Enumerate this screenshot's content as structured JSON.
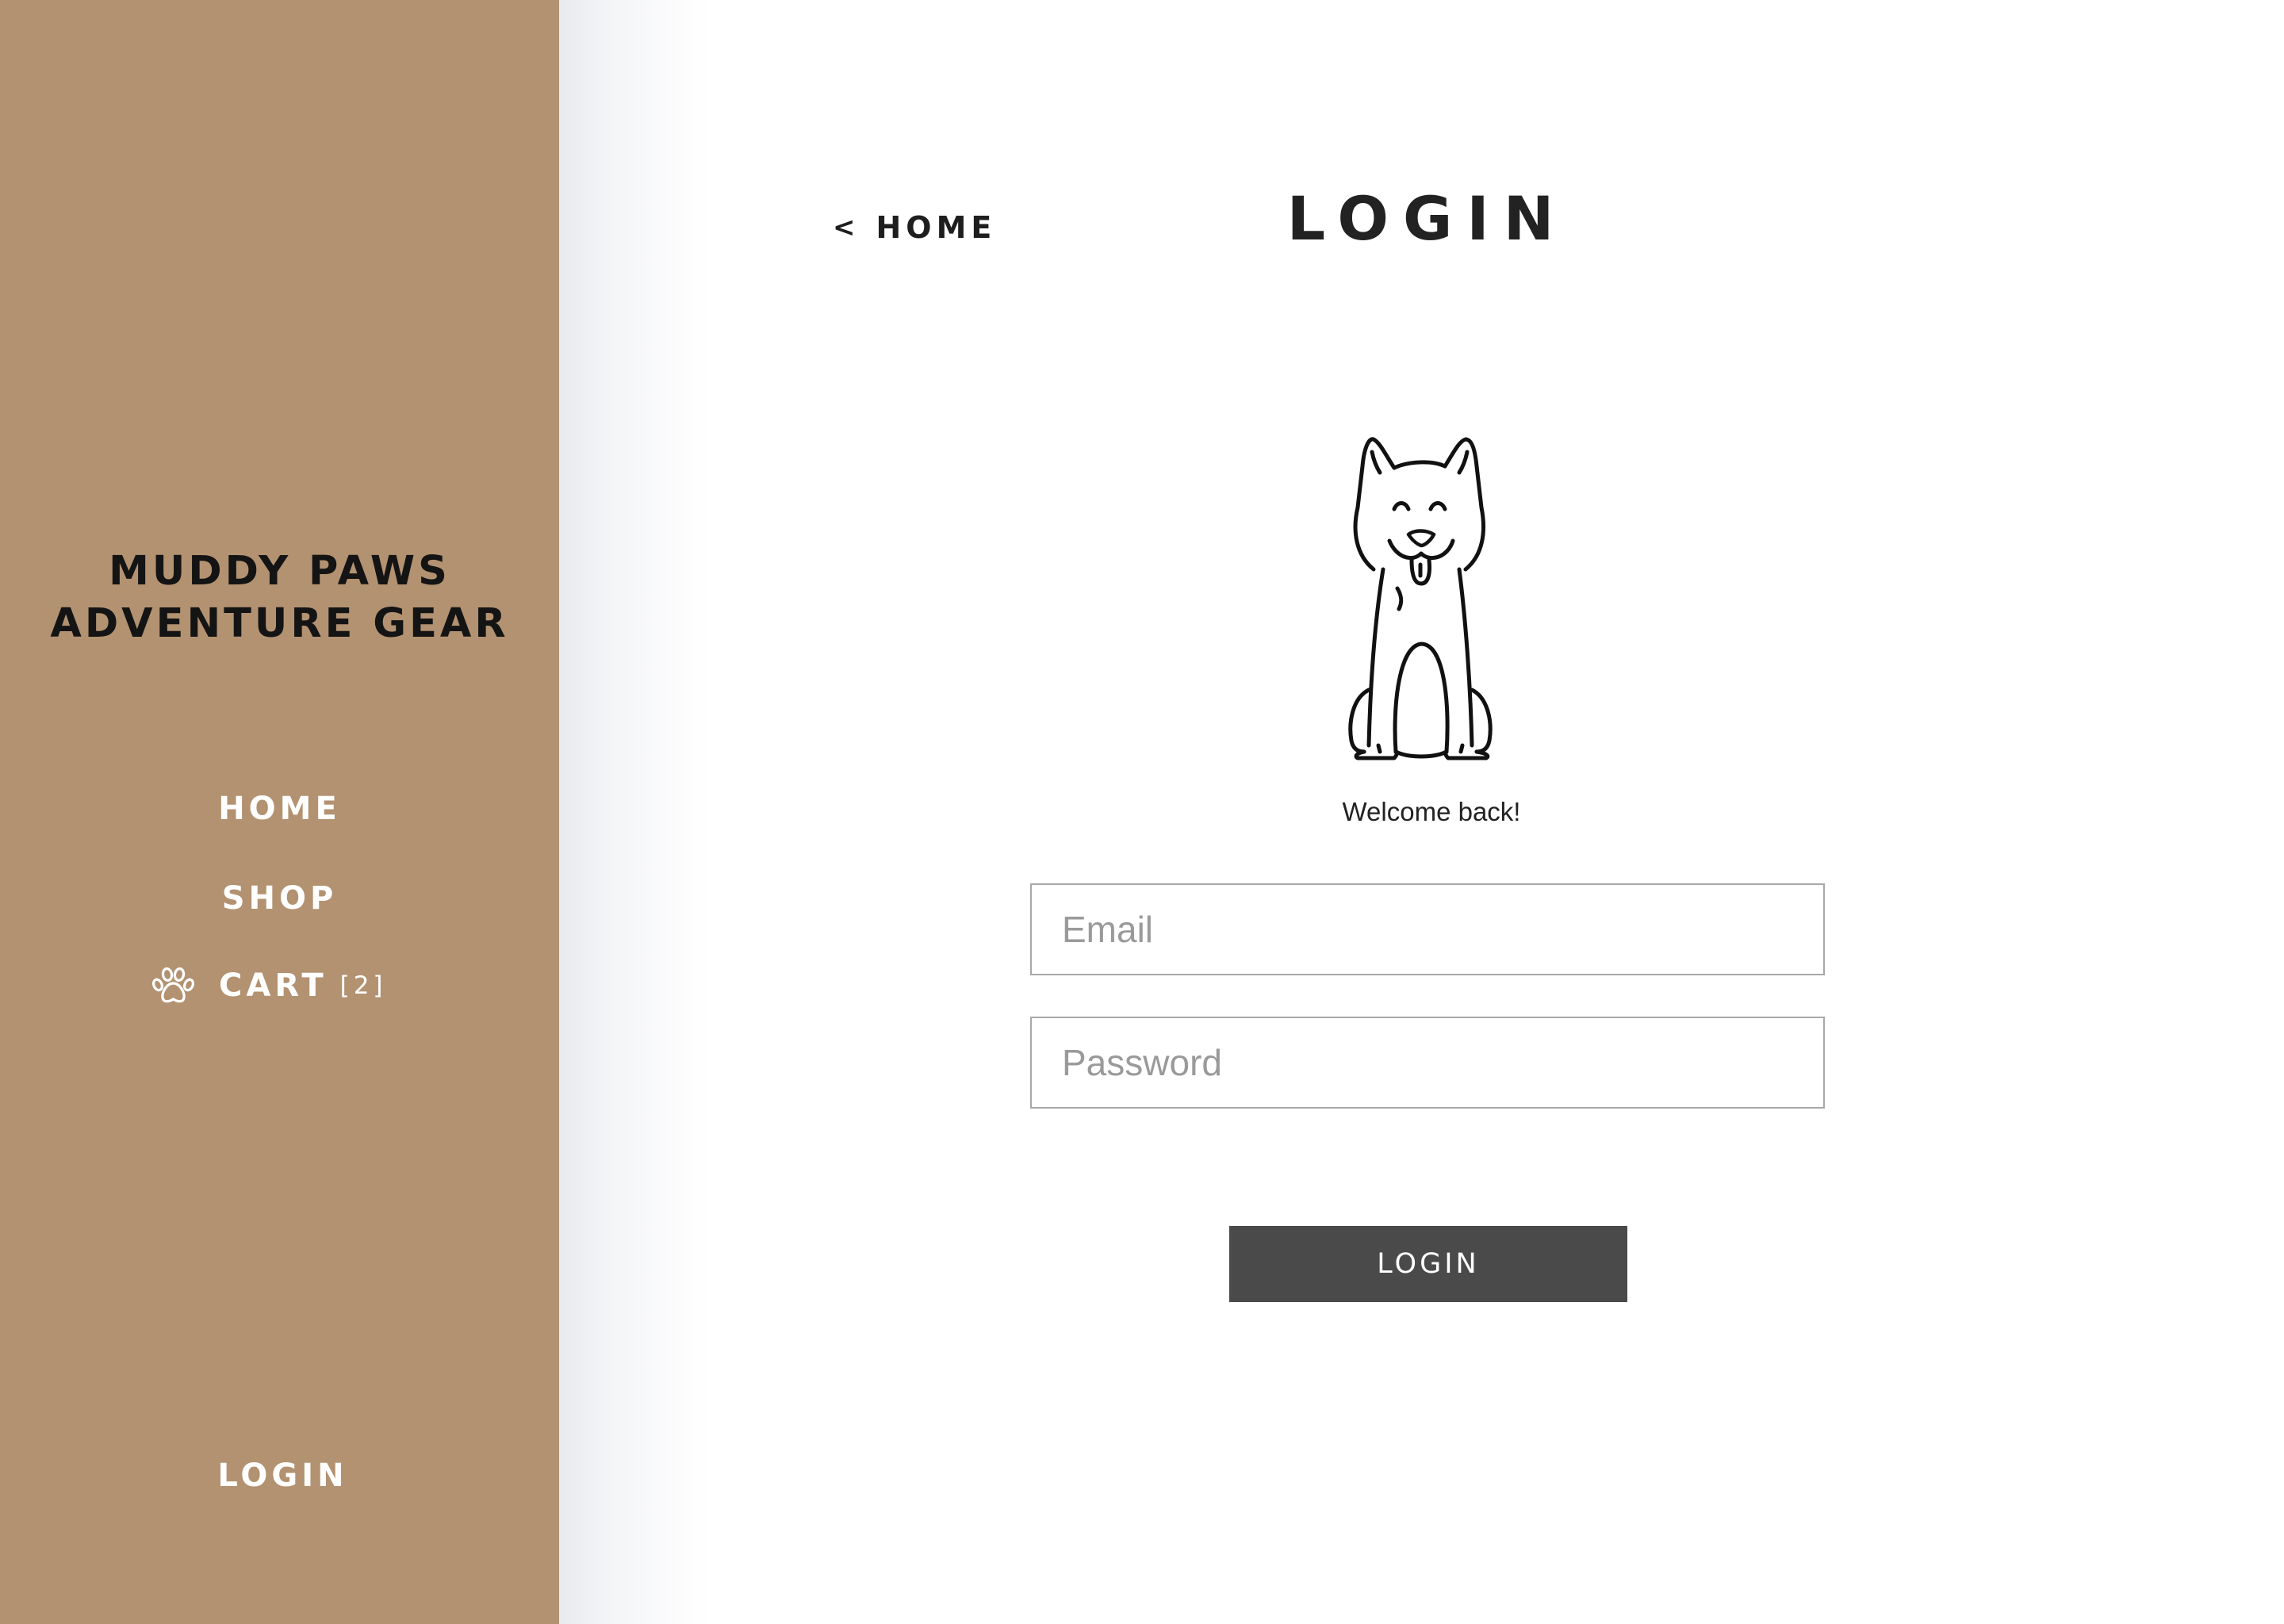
{
  "sidebar": {
    "brand_line1": "MUDDY PAWS",
    "brand_line2": "ADVENTURE GEAR",
    "nav": {
      "home": "HOME",
      "shop": "SHOP",
      "cart": "CART",
      "cart_count": "[2]",
      "cart_icon": "paw-icon",
      "login": "LOGIN"
    },
    "background_color": "#b39271"
  },
  "header": {
    "back_icon": "<",
    "back_label": "HOME",
    "title": "LOGIN"
  },
  "main": {
    "illustration": "dog-illustration",
    "welcome_text": "Welcome back!",
    "email_placeholder": "Email",
    "password_placeholder": "Password",
    "login_button_label": "LOGIN",
    "button_color": "#4a4a4a"
  }
}
